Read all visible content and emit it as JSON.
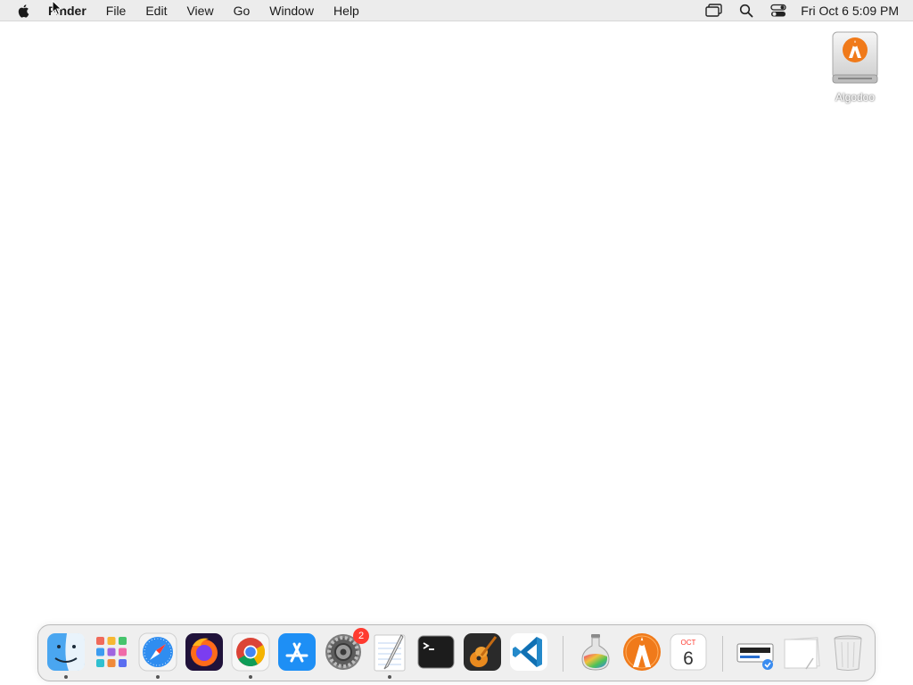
{
  "menubar": {
    "app_name": "Finder",
    "items": [
      "File",
      "Edit",
      "View",
      "Go",
      "Window",
      "Help"
    ],
    "clock": "Fri Oct 6  5:09 PM"
  },
  "desktop": {
    "icons": [
      {
        "label": "Algodoo"
      }
    ]
  },
  "dock": {
    "apps": [
      {
        "name": "Finder",
        "icon": "finder-icon",
        "running": true
      },
      {
        "name": "Launchpad",
        "icon": "launchpad-icon",
        "running": false
      },
      {
        "name": "Safari",
        "icon": "safari-icon",
        "running": true
      },
      {
        "name": "Firefox",
        "icon": "firefox-icon",
        "running": false
      },
      {
        "name": "Google Chrome",
        "icon": "chrome-icon",
        "running": true
      },
      {
        "name": "App Store",
        "icon": "app-store-icon",
        "running": false
      },
      {
        "name": "System Preferences",
        "icon": "system-preferences-icon",
        "running": false,
        "badge": "2"
      },
      {
        "name": "TextEdit",
        "icon": "textedit-icon",
        "running": true
      },
      {
        "name": "Terminal",
        "icon": "terminal-icon",
        "running": false
      },
      {
        "name": "GarageBand",
        "icon": "garageband-icon",
        "running": false
      },
      {
        "name": "Visual Studio Code",
        "icon": "vscode-icon",
        "running": false
      },
      {
        "name": "Colorsync",
        "icon": "flask-icon",
        "running": false
      },
      {
        "name": "Algodoo",
        "icon": "algodoo-icon",
        "running": false
      },
      {
        "name": "Calendar",
        "icon": "calendar-icon",
        "running": false,
        "month": "OCT",
        "day": "6"
      },
      {
        "name": "Downloads",
        "icon": "downloads-stack-icon",
        "running": false
      },
      {
        "name": "Documents",
        "icon": "documents-stack-icon",
        "running": false
      },
      {
        "name": "Trash",
        "icon": "trash-icon",
        "running": false
      }
    ]
  },
  "colors": {
    "menubar_bg": "#ececec",
    "badge": "#ff3b30",
    "algodoo_orange": "#f07a1a"
  }
}
